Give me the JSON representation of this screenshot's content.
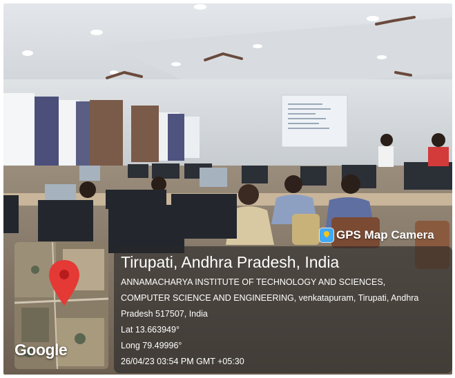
{
  "badge": {
    "label": "GPS Map Camera",
    "icon": "map-pin-camera-icon"
  },
  "location": {
    "title": "Tirupati, Andhra Pradesh, India",
    "address_line1": "ANNAMACHARYA INSTITUTE OF TECHNOLOGY AND SCIENCES,",
    "address_line2": "COMPUTER SCIENCE AND ENGINEERING, venkatapuram, Tirupati, Andhra",
    "address_line3": "Pradesh 517507, India",
    "lat": "Lat 13.663949°",
    "long": "Long 79.49996°",
    "timestamp": "26/04/23 03:54 PM GMT +05:30"
  },
  "map": {
    "logo_text": "Google",
    "pin_color": "#e53935"
  },
  "colors": {
    "panel": "#282828",
    "pin": "#e53935",
    "wall": "#e9ecef"
  }
}
